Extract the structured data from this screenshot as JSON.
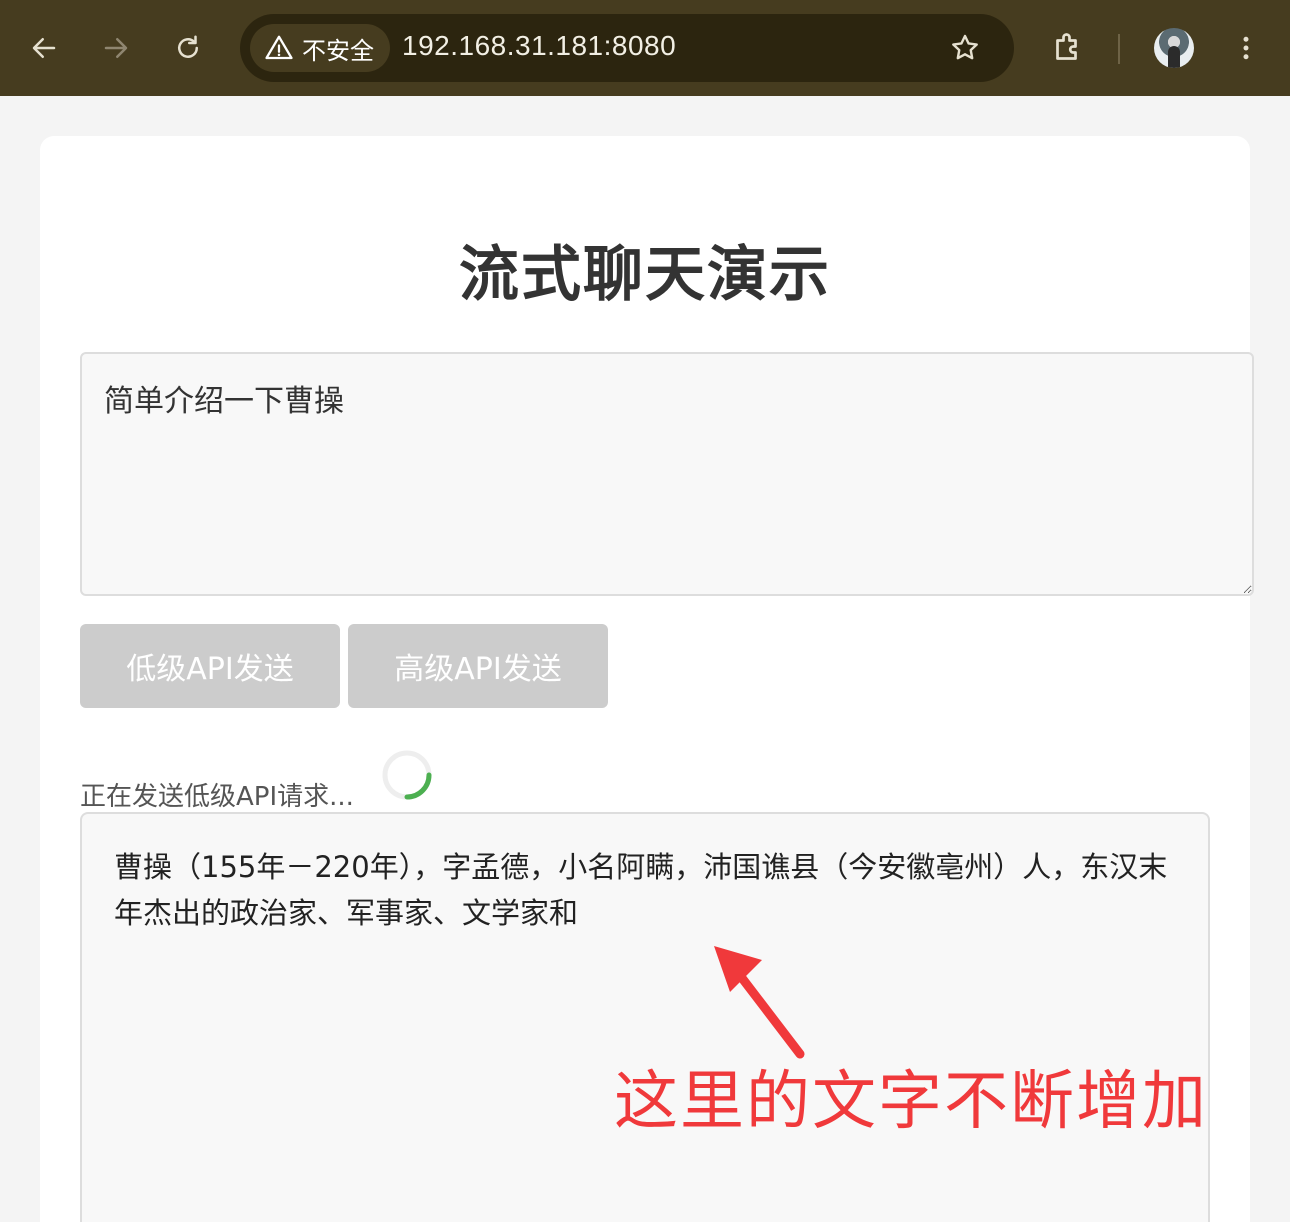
{
  "browser": {
    "security_label": "不安全",
    "url": "192.168.31.181:8080",
    "icons": [
      "back-arrow-icon",
      "forward-arrow-icon",
      "reload-icon",
      "warning-triangle-icon",
      "star-icon",
      "extensions-puzzle-icon",
      "profile-avatar",
      "kebab-menu-icon"
    ]
  },
  "page": {
    "title": "流式聊天演示",
    "prompt_value": "简单介绍一下曹操",
    "buttons": {
      "low_api": "低级API发送",
      "high_api": "高级API发送"
    },
    "status": "正在发送低级API请求...",
    "response": "曹操（155年－220年），字孟德，小名阿瞒，沛国谯县（今安徽亳州）人，东汉末年杰出的政治家、军事家、文学家和"
  },
  "annotation": {
    "text": "这里的文字不断增加",
    "color": "#f0393b"
  },
  "colors": {
    "toolbar_bg": "#463c1f",
    "button_disabled": "#cccccc",
    "spinner_accent": "#4caf50"
  }
}
